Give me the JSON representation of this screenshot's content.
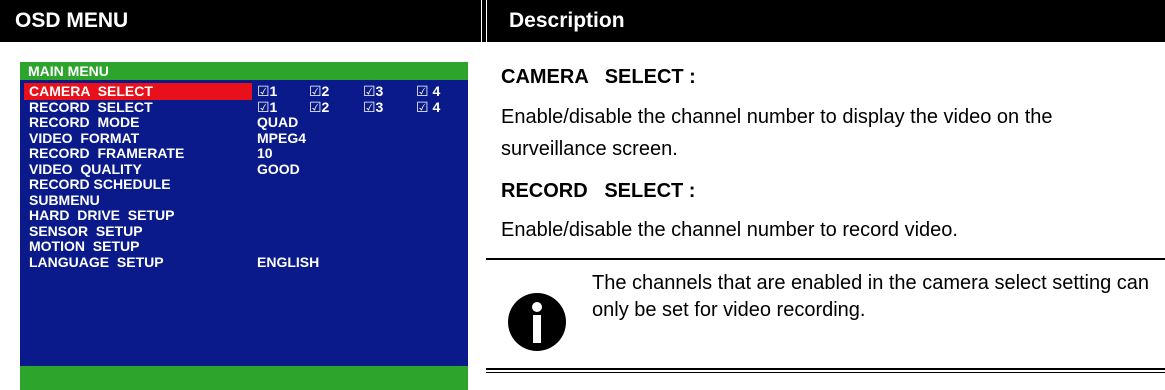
{
  "header": {
    "left": "OSD MENU",
    "right": "Description"
  },
  "osd": {
    "title": "MAIN  MENU",
    "rows": [
      {
        "label": "CAMERA  SELECT",
        "value": "",
        "checks": [
          "☑1",
          "☑2",
          "☑3",
          "☑ 4"
        ],
        "selected": true
      },
      {
        "label": "RECORD  SELECT",
        "value": "",
        "checks": [
          "☑1",
          "☑2",
          "☑3",
          "☑ 4"
        ],
        "selected": false
      },
      {
        "label": "RECORD  MODE",
        "value": "QUAD",
        "checks": [],
        "selected": false
      },
      {
        "label": "VIDEO  FORMAT",
        "value": "MPEG4",
        "checks": [],
        "selected": false
      },
      {
        "label": "RECORD  FRAMERATE",
        "value": "10",
        "checks": [],
        "selected": false
      },
      {
        "label": "VIDEO  QUALITY",
        "value": "GOOD",
        "checks": [],
        "selected": false
      },
      {
        "label": "RECORD SCHEDULE",
        "value": "",
        "checks": [],
        "selected": false
      },
      {
        "label": "SUBMENU",
        "value": "",
        "checks": [],
        "selected": false
      },
      {
        "label": "HARD  DRIVE  SETUP",
        "value": "",
        "checks": [],
        "selected": false
      },
      {
        "label": "SENSOR  SETUP",
        "value": "",
        "checks": [],
        "selected": false
      },
      {
        "label": "MOTION  SETUP",
        "value": "",
        "checks": [],
        "selected": false
      },
      {
        "label": "LANGUAGE  SETUP",
        "value": "ENGLISH",
        "checks": [],
        "selected": false
      }
    ]
  },
  "description": {
    "camera_heading": "CAMERA   SELECT :",
    "camera_text": "Enable/disable the channel number to display the video on the surveillance screen.",
    "record_heading": "RECORD   SELECT :",
    "record_text": "Enable/disable the channel number to record video.",
    "note": "The channels that are enabled in the camera select setting can only be set for video recording.",
    "note_icon": "info-icon"
  },
  "colors": {
    "osd_background": "#0a1a8a",
    "osd_title_bar": "#2da52d",
    "osd_selection": "#e8101a",
    "header_background": "#000000"
  }
}
